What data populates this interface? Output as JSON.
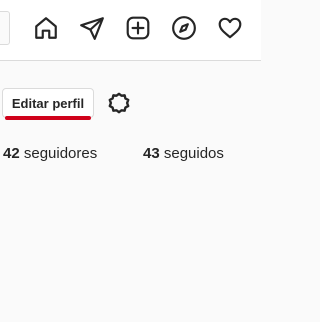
{
  "navbar": {
    "icons": [
      "home-icon",
      "direct-icon",
      "new-post-icon",
      "explore-icon",
      "activity-icon"
    ]
  },
  "profile": {
    "edit_button_label": "Editar perfil",
    "settings_icon": "gear-icon",
    "followers_count": "42",
    "followers_label": " seguidores",
    "following_count": "43",
    "following_label": " seguidos"
  },
  "colors": {
    "annotation_underline": "#d0021b",
    "text": "#262626",
    "border": "#dbdbdb"
  }
}
